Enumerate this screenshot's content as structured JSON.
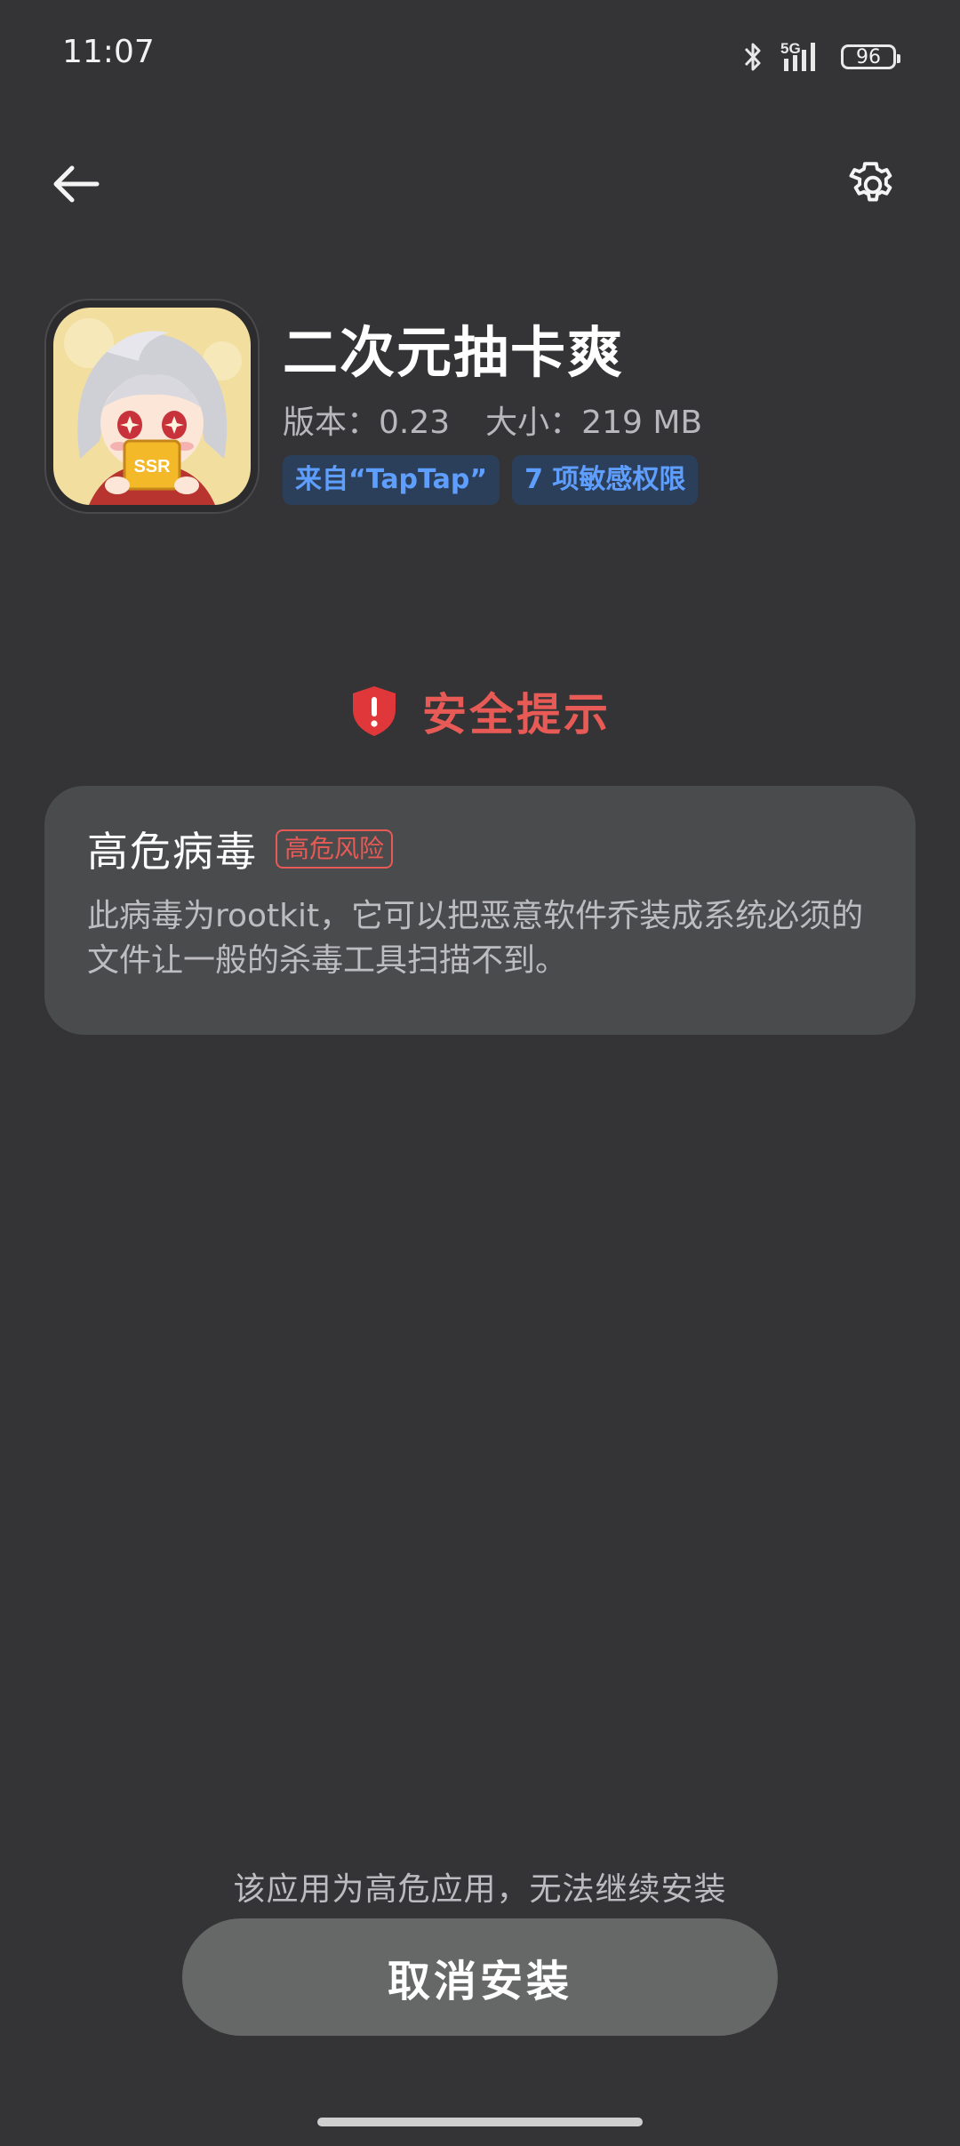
{
  "status_bar": {
    "time": "11:07",
    "network": "5G",
    "battery": "96"
  },
  "header": {
    "back_icon": "arrow-left-icon",
    "settings_icon": "gear-icon"
  },
  "app": {
    "name": "二次元抽卡爽",
    "version_label": "版本：0.23",
    "size_label": "大小：219 MB",
    "chips": [
      "来自“TapTap”",
      "7 项敏感权限"
    ],
    "icon_badge": "SSR"
  },
  "security": {
    "title": "安全提示",
    "icon": "shield-alert-icon",
    "card": {
      "title": "高危病毒",
      "badge": "高危风险",
      "description": "此病毒为rootkit，它可以把恶意软件乔装成系统必须的文件让一般的杀毒工具扫描不到。"
    }
  },
  "footer": {
    "warning": "该应用为高危应用，无法继续安装",
    "cancel_label": "取消安装"
  },
  "colors": {
    "background": "#343436",
    "danger": "#e85a55",
    "chip_text": "#5e9eff",
    "chip_bg": "#2c3f5a",
    "card_bg": "#4a4b4d",
    "button_bg": "#666767"
  }
}
